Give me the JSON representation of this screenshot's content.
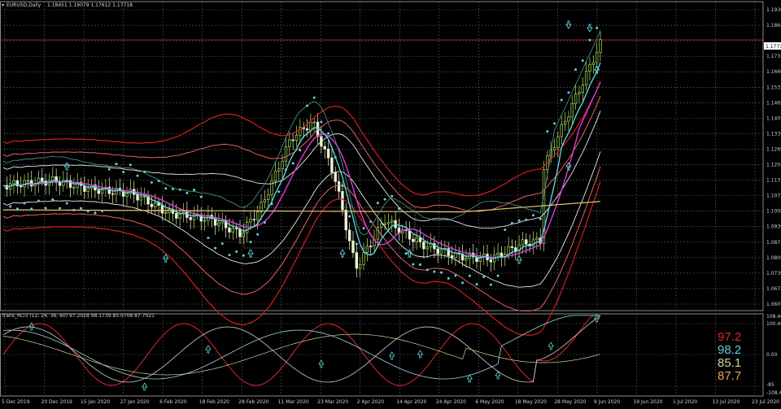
{
  "window": {
    "title": "EURUSD,Daily",
    "ohlc": "1.18451 1.19079 1.17612 1.17718"
  },
  "price_axis": {
    "ticks": [
      "1.19300",
      "1.18645",
      "1.17718",
      "1.17315",
      "1.16605",
      "1.15310",
      "1.14655",
      "1.14010",
      "1.13350",
      "1.12690",
      "1.12035",
      "1.11375",
      "1.10710",
      "1.10055",
      "1.09390",
      "1.08730",
      "1.08055",
      "1.07395",
      "1.06735",
      "1.06075"
    ],
    "current_price": "1.17718"
  },
  "indicator": {
    "header": "Trans_RCI3 (12, 24, 36, 60) 97.2028 98.1739 85.0708 87.7021",
    "axis_ticks": [
      "108.4615",
      "100.461",
      "0.00",
      "-85",
      "-108.461"
    ],
    "values": [
      {
        "label": "97.2",
        "color": "#e0262a"
      },
      {
        "label": "98.2",
        "color": "#5fd3d8"
      },
      {
        "label": "85.1",
        "color": "#c8d99a"
      },
      {
        "label": "87.7",
        "color": "#e8a25a"
      }
    ]
  },
  "time_axis": {
    "ticks": [
      "5 Dec 2019",
      "20 Dec 2019",
      "15 Jan 2020",
      "27 Jan 2020",
      "6 Feb 2020",
      "18 Feb 2020",
      "28 Feb 2020",
      "11 Mar 2020",
      "23 Mar 2020",
      "2 Apr 2020",
      "14 Apr 2020",
      "24 Apr 2020",
      "6 May 2020",
      "18 May 2020",
      "28 May 2020",
      "9 Jun 2020",
      "19 Jun 2020",
      "1 Jul 2020",
      "13 Jul 2020",
      "23 Jul 2020"
    ]
  },
  "colors": {
    "bull": "#b9e86c",
    "bear": "#e9f5cf",
    "bb_outer": "#d21f1f",
    "bb_mid": "#ff6a6a",
    "white_band": "#e8e8e8",
    "teal": "#5fd3d8",
    "magenta": "#e23ad8",
    "yellow_ma": "#e9c36a",
    "sar": "#5fd3d8",
    "grid": "#5a5a5a"
  }
}
